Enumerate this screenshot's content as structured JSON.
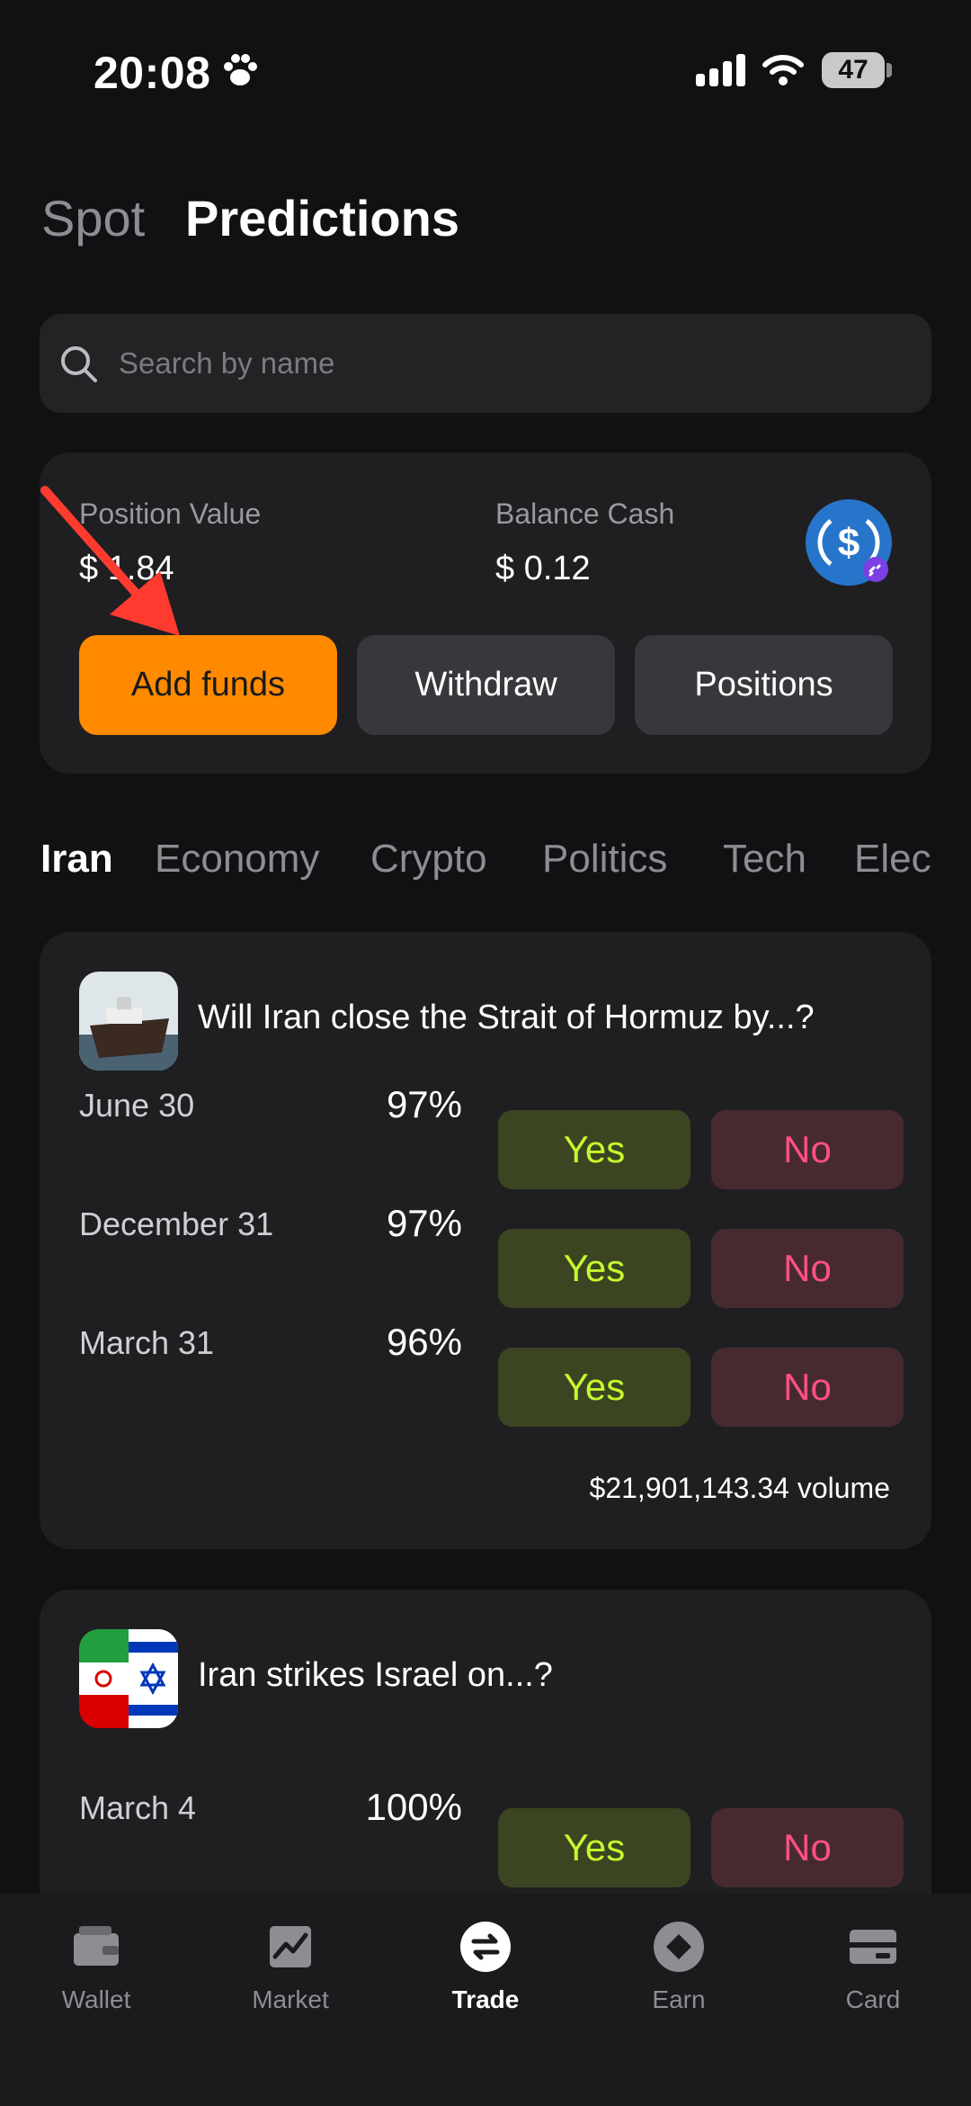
{
  "status_bar": {
    "time": "20:08",
    "battery": "47"
  },
  "header": {
    "tabs": [
      "Spot",
      "Predictions"
    ],
    "active_tab": "Predictions"
  },
  "search": {
    "placeholder": "Search by name",
    "value": ""
  },
  "balance": {
    "position_value_label": "Position Value",
    "position_value": "$ 1.84",
    "balance_cash_label": "Balance Cash",
    "balance_cash": "$ 0.12",
    "buttons": {
      "add_funds": "Add funds",
      "withdraw": "Withdraw",
      "positions": "Positions"
    }
  },
  "categories": [
    "Iran",
    "Economy",
    "Crypto",
    "Politics",
    "Tech",
    "Elec"
  ],
  "active_category": "Iran",
  "markets": [
    {
      "title": "Will Iran close the Strait of Hormuz by...?",
      "rows": [
        {
          "label": "June 30",
          "pct": "97%",
          "yes": "Yes",
          "no": "No"
        },
        {
          "label": "December 31",
          "pct": "97%",
          "yes": "Yes",
          "no": "No"
        },
        {
          "label": "March 31",
          "pct": "96%",
          "yes": "Yes",
          "no": "No"
        }
      ],
      "volume": "$21,901,143.34 volume"
    },
    {
      "title": "Iran strikes Israel on...?",
      "rows": [
        {
          "label": "March 4",
          "pct": "100%",
          "yes": "Yes",
          "no": "No"
        }
      ]
    }
  ],
  "bottom_nav": [
    {
      "label": "Wallet",
      "icon": "wallet-icon"
    },
    {
      "label": "Market",
      "icon": "chart-icon"
    },
    {
      "label": "Trade",
      "icon": "swap-icon"
    },
    {
      "label": "Earn",
      "icon": "diamond-icon"
    },
    {
      "label": "Card",
      "icon": "card-icon"
    }
  ],
  "active_nav": "Trade",
  "colors": {
    "accent": "#ff8a00",
    "yes": "#c7f82e",
    "no": "#ff4f86",
    "annotation_arrow": "#ff3b30",
    "usdc": "#2775ca"
  }
}
